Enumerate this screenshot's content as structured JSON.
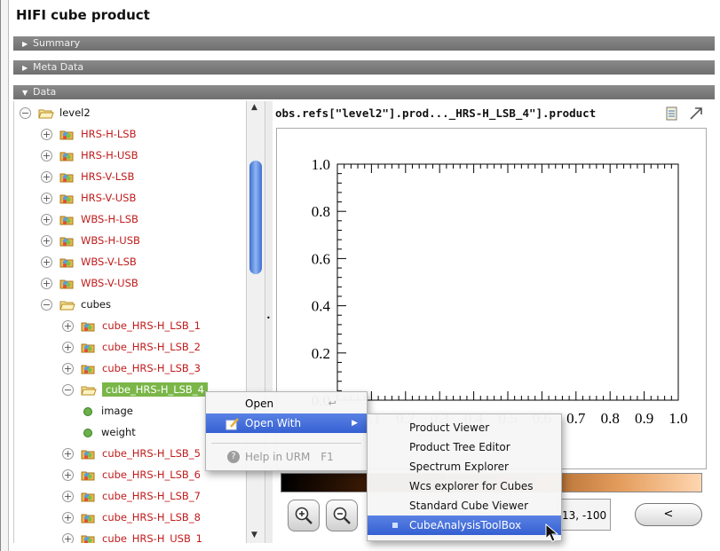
{
  "title": "HIFI cube product",
  "sections": {
    "summary": "Summary",
    "meta": "Meta Data",
    "data": "Data"
  },
  "tree": [
    {
      "label": "level2",
      "kind": "root",
      "expanded": true
    },
    {
      "label": "HRS-H-LSB",
      "kind": "folder"
    },
    {
      "label": "HRS-H-USB",
      "kind": "folder"
    },
    {
      "label": "HRS-V-LSB",
      "kind": "folder"
    },
    {
      "label": "HRS-V-USB",
      "kind": "folder"
    },
    {
      "label": "WBS-H-LSB",
      "kind": "folder"
    },
    {
      "label": "WBS-H-USB",
      "kind": "folder"
    },
    {
      "label": "WBS-V-LSB",
      "kind": "folder"
    },
    {
      "label": "WBS-V-USB",
      "kind": "folder"
    },
    {
      "label": "cubes",
      "kind": "open",
      "expanded": true
    },
    {
      "label": "cube_HRS-H_LSB_1",
      "kind": "folder"
    },
    {
      "label": "cube_HRS-H_LSB_2",
      "kind": "folder"
    },
    {
      "label": "cube_HRS-H_LSB_3",
      "kind": "folder"
    },
    {
      "label": "cube_HRS-H_LSB_4",
      "kind": "selected",
      "expanded": true
    },
    {
      "label": "image",
      "kind": "leaf"
    },
    {
      "label": "weight",
      "kind": "leaf"
    },
    {
      "label": "cube_HRS-H_LSB_5",
      "kind": "folder"
    },
    {
      "label": "cube_HRS-H_LSB_6",
      "kind": "folder"
    },
    {
      "label": "cube_HRS-H_LSB_7",
      "kind": "folder"
    },
    {
      "label": "cube_HRS-H_LSB_8",
      "kind": "folder"
    },
    {
      "label": "cube_HRS-H_USB_1",
      "kind": "folder"
    }
  ],
  "right_panel": {
    "header": "obs.refs[\"level2\"].prod..._HRS-H_LSB_4\"].product",
    "coord": "13, -100",
    "back_label": "<"
  },
  "plot": {
    "y_ticks": [
      "1.0",
      "0.8",
      "0.6",
      "0.4",
      "0.2",
      "0.0"
    ],
    "x_ticks": [
      "0.0",
      "0.1",
      "0.2",
      "0.3",
      "0.4",
      "0.5",
      "0.6",
      "0.7",
      "0.8",
      "0.9",
      "1.0"
    ]
  },
  "context_menu": {
    "open": "Open",
    "open_with": "Open With",
    "help": "Help in URM",
    "help_shortcut": "F1"
  },
  "submenu": [
    "Product Viewer",
    "Product Tree Editor",
    "Spectrum Explorer",
    "Wcs explorer for Cubes",
    "Standard Cube Viewer",
    "CubeAnalysisToolBox"
  ],
  "colors": {
    "selection": "#7ab648",
    "menu_highlight": "#3d67d8",
    "tree_red": "#c01b1b"
  }
}
